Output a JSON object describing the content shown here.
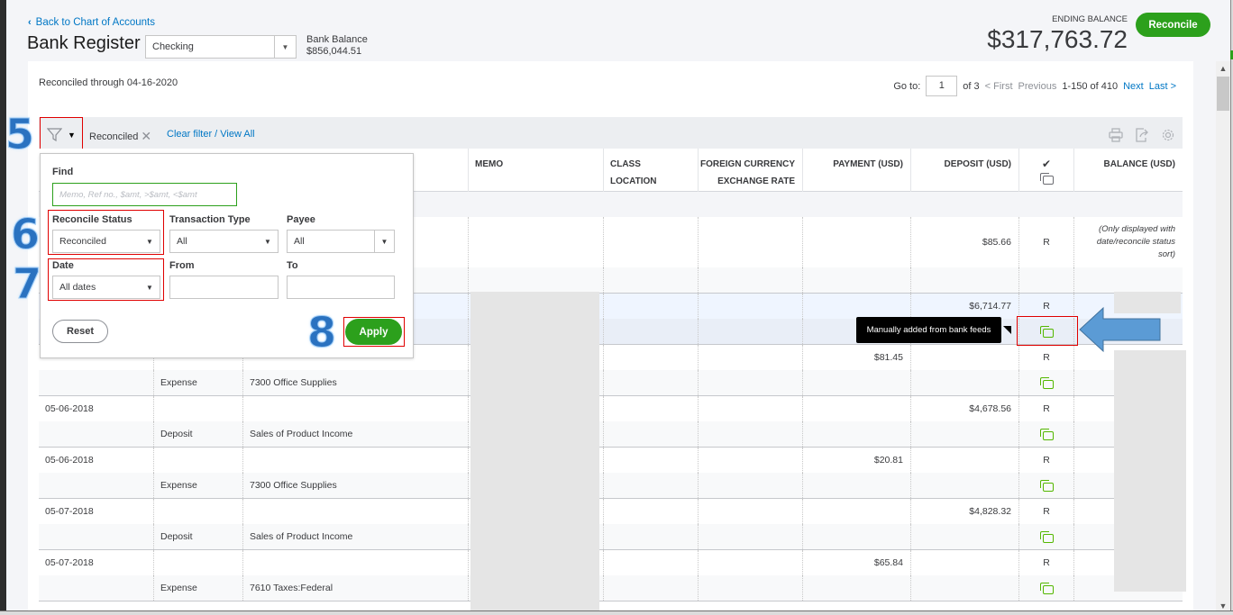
{
  "header": {
    "back_link": "Back to Chart of Accounts",
    "title": "Bank Register",
    "account_select": "Checking",
    "bank_balance_label": "Bank Balance",
    "bank_balance_value": "$856,044.51",
    "ending_balance_label": "ENDING BALANCE",
    "ending_balance_value": "$317,763.72",
    "reconcile_button": "Reconcile"
  },
  "info": {
    "reconciled_through": "Reconciled through 04-16-2020"
  },
  "pager": {
    "goto_label": "Go to:",
    "goto_value": "1",
    "of_pages": "of 3",
    "first": "< First",
    "previous": "Previous",
    "range": "1-150 of 410",
    "next": "Next",
    "last": "Last >"
  },
  "toolbar": {
    "filter_chip": "Reconciled",
    "clear_filter": "Clear filter / View All",
    "icons": [
      "print-icon",
      "export-icon",
      "settings-gear-icon"
    ]
  },
  "columns": {
    "memo": "MEMO",
    "class": "CLASS",
    "location": "LOCATION",
    "fx_line1": "FOREIGN CURRENCY",
    "fx_line2": "EXCHANGE RATE",
    "payment": "PAYMENT (USD)",
    "deposit": "DEPOSIT (USD)",
    "check_icon": "checkmark-icon",
    "bankfeed_icon": "bank-feed-icon",
    "balance": "BALANCE (USD)"
  },
  "rows": [
    {
      "date": "",
      "type": "",
      "account": "",
      "payment": "",
      "deposit": "$85.66",
      "status": "R",
      "bankfeed": false,
      "balance_note": "(Only displayed with date/reconcile status sort)"
    },
    {
      "date": "",
      "type": "",
      "account": "",
      "payment": "",
      "deposit": "$6,714.77",
      "status": "R",
      "bankfeed": true,
      "highlight": true
    },
    {
      "date": "",
      "type": "Expense",
      "account": "7300 Office Supplies",
      "payment": "$81.45",
      "deposit": "",
      "status": "R",
      "bankfeed": true
    },
    {
      "date": "05-06-2018",
      "type": "Deposit",
      "account": "Sales of Product Income",
      "payment": "",
      "deposit": "$4,678.56",
      "status": "R",
      "bankfeed": true
    },
    {
      "date": "05-06-2018",
      "type": "Expense",
      "account": "7300 Office Supplies",
      "payment": "$20.81",
      "deposit": "",
      "status": "R",
      "bankfeed": true
    },
    {
      "date": "05-07-2018",
      "type": "Deposit",
      "account": "Sales of Product Income",
      "payment": "",
      "deposit": "$4,828.32",
      "status": "R",
      "bankfeed": true
    },
    {
      "date": "05-07-2018",
      "type": "Expense",
      "account": "7610 Taxes:Federal",
      "payment": "$65.84",
      "deposit": "",
      "status": "R",
      "bankfeed": true
    }
  ],
  "tooltip": "Manually added from bank feeds",
  "filter_dropdown": {
    "find_label": "Find",
    "find_placeholder": "Memo, Ref no., $amt, >$amt, <$amt",
    "reconcile_status_label": "Reconcile Status",
    "reconcile_status_value": "Reconciled",
    "transaction_type_label": "Transaction Type",
    "transaction_type_value": "All",
    "payee_label": "Payee",
    "payee_value": "All",
    "date_label": "Date",
    "date_value": "All dates",
    "from_label": "From",
    "from_value": "",
    "to_label": "To",
    "to_value": "",
    "reset_button": "Reset",
    "apply_button": "Apply"
  },
  "annotations": {
    "step5": "5",
    "step6": "6",
    "step7": "7",
    "step8": "8",
    "arrow_color": "#5b9bd5",
    "highlight_color": "#e00000"
  },
  "colors": {
    "brand_green": "#2ca01c",
    "link_blue": "#0077c5"
  }
}
